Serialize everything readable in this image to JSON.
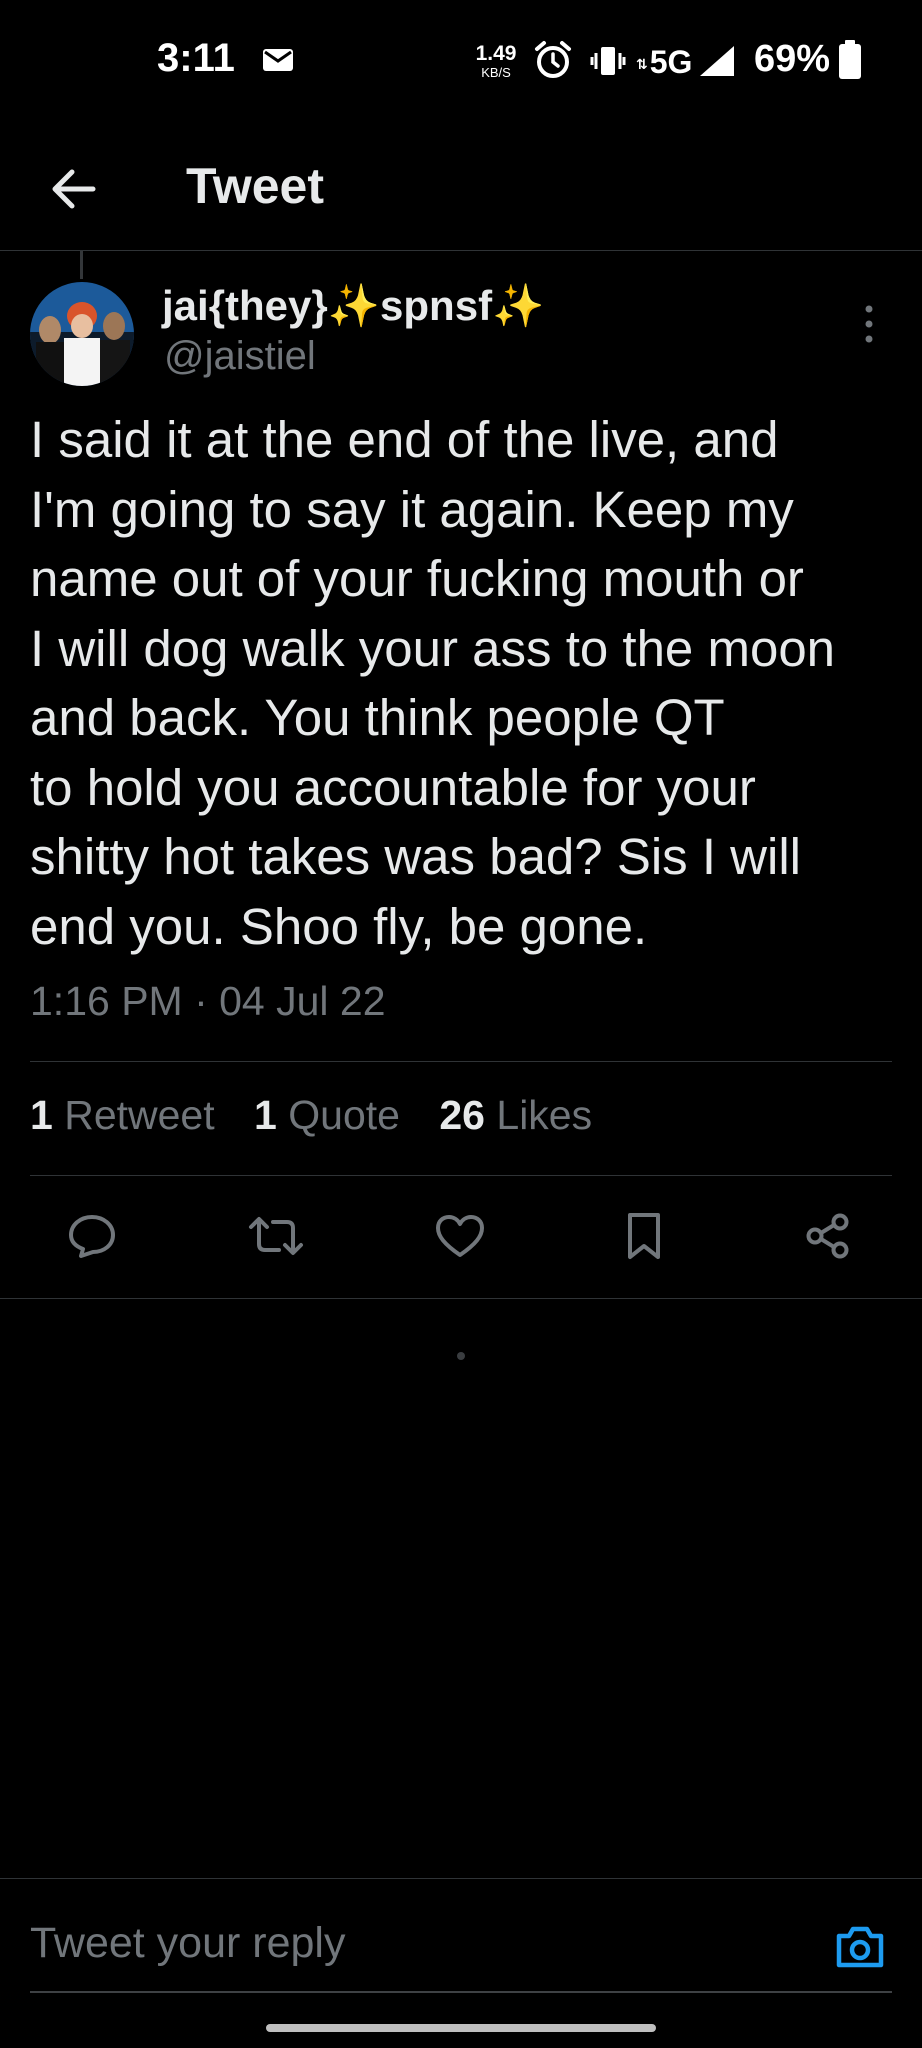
{
  "status_bar": {
    "time": "3:11",
    "net_speed_value": "1.49",
    "net_speed_unit": "KB/S",
    "network": "5G",
    "battery": "69%"
  },
  "header": {
    "title": "Tweet"
  },
  "tweet": {
    "display_name": "jai{they}✨spnsf✨",
    "handle": "@jaistiel",
    "text": "I said it at the end of the live, and\nI'm going to say it again. Keep my\nname out of your fucking mouth or\nI will dog walk your ass to the moon\nand back. You think people QT\nto hold you accountable for your\nshitty hot takes was bad? Sis I will\nend you. Shoo fly, be gone.",
    "timestamp": "1:16 PM · 04 Jul 22"
  },
  "stats": {
    "retweets_count": "1",
    "retweets_label": "Retweet",
    "quotes_count": "1",
    "quotes_label": "Quote",
    "likes_count": "26",
    "likes_label": "Likes"
  },
  "actions": [
    "reply-icon",
    "retweet-icon",
    "like-icon",
    "bookmark-icon",
    "share-icon"
  ],
  "reply_bar": {
    "placeholder": "Tweet your reply"
  },
  "colors": {
    "background": "#000000",
    "text_primary": "#e7e9ea",
    "text_secondary": "#71767b",
    "divider": "#2f3336",
    "accent": "#1d9bf0"
  }
}
